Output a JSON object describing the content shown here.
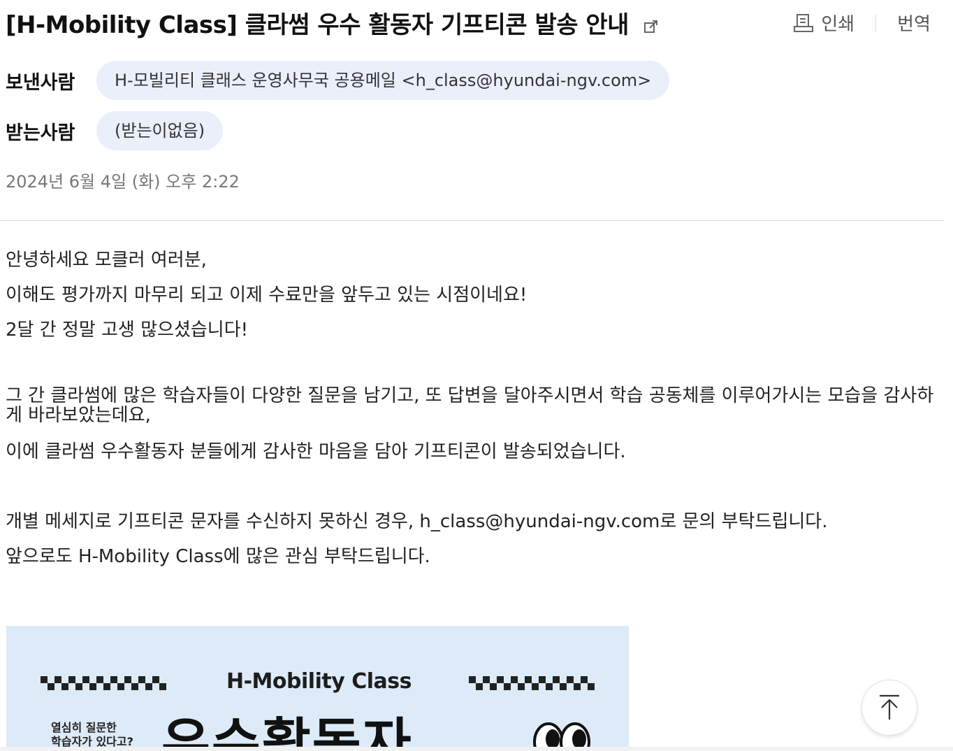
{
  "mail": {
    "subject": "[H-Mobility Class] 클라썸 우수 활동자 기프티콘 발송 안내",
    "toolbar": {
      "print_label": "인쇄",
      "translate_label": "번역"
    },
    "sender": {
      "label": "보낸사람",
      "value": "H-모빌리티 클래스 운영사무국 공용메일 <h_class@hyundai-ngv.com>"
    },
    "recipient": {
      "label": "받는사람",
      "value": "(받는이없음)"
    },
    "date": "2024년 6월 4일 (화) 오후 2:22"
  },
  "body": {
    "paragraphs": [
      "안녕하세요 모클러 여러분,",
      "이해도 평가까지 마무리 되고 이제 수료만을 앞두고 있는 시점이네요!",
      "2달 간 정말 고생 많으셨습니다!",
      "그 간 클라썸에 많은 학습자들이 다양한 질문을 남기고, 또 답변을 달아주시면서 학습 공동체를 이루어가시는 모습을 감사하게 바라보았는데요,",
      "이에 클라썸 우수활동자 분들에게 감사한 마음을 담아 기프티콘이 발송되었습니다.",
      "개별 메세지로 기프티콘 문자를 수신하지 못하신 경우, h_class@hyundai-ngv.com로 문의 부탁드립니다.",
      "앞으로도 H-Mobility Class에 많은 관심 부탁드립니다."
    ]
  },
  "banner": {
    "title": "H-Mobility Class",
    "side_line1": "열심히 질문한",
    "side_line2": "학습자가 있다고?",
    "headline": "우수활동자"
  },
  "colors": {
    "chip_bg": "#eaeff9",
    "banner_bg": "#dcebf7"
  }
}
